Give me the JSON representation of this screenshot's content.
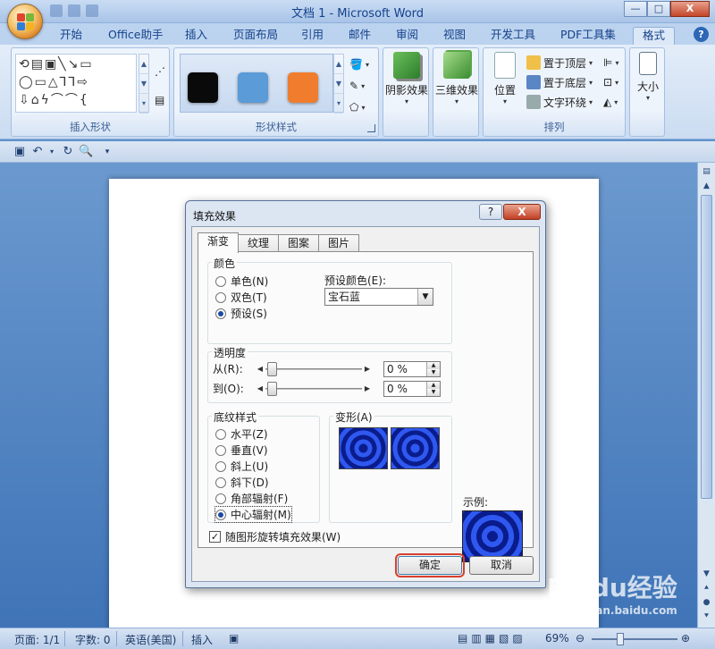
{
  "window": {
    "title": "文档 1 - Microsoft Word",
    "minimize": "—",
    "maximize": "□",
    "close": "X"
  },
  "tabs": [
    "开始",
    "Office助手",
    "插入",
    "页面布局",
    "引用",
    "邮件",
    "审阅",
    "视图",
    "开发工具",
    "PDF工具集",
    "格式"
  ],
  "active_tab": "格式",
  "help": "?",
  "ribbon": {
    "insert_shapes": {
      "label": "插入形状",
      "gallery": "↺▭▣╲╲▭\n◯▭△⅂⅂⇨\n⇩⌂∿⌒⌒{"
    },
    "shape_styles": {
      "label": "形状样式",
      "swatches": [
        "#0a0a0a",
        "#5a9bd8",
        "#ef7d2d"
      ]
    },
    "shadow": {
      "label": "阴影效果"
    },
    "three_d": {
      "label": "三维效果"
    },
    "arrange": {
      "label": "排列",
      "position": "位置",
      "bring_front": "置于顶层",
      "send_back": "置于底层",
      "wrap_text": "文字环绕"
    },
    "size": {
      "label": "大小"
    }
  },
  "dialog": {
    "title": "填充效果",
    "help": "?",
    "close": "X",
    "tabs": [
      "渐变",
      "纹理",
      "图案",
      "图片"
    ],
    "selected_tab": "渐变",
    "colors": {
      "legend": "颜色",
      "options": [
        "单色(N)",
        "双色(T)",
        "预设(S)"
      ],
      "selected": "预设(S)",
      "preset_label": "预设颜色(E):",
      "preset_value": "宝石蓝"
    },
    "transparency": {
      "legend": "透明度",
      "from_label": "从(R):",
      "to_label": "到(O):",
      "from_value": "0 %",
      "to_value": "0 %",
      "from_level": 0,
      "to_level": 0
    },
    "shading": {
      "legend": "底纹样式",
      "options": [
        "水平(Z)",
        "垂直(V)",
        "斜上(U)",
        "斜下(D)",
        "角部辐射(F)",
        "中心辐射(M)"
      ],
      "selected": "中心辐射(M)"
    },
    "variants": {
      "legend": "变形(A)"
    },
    "sample_label": "示例:",
    "rotate_checkbox": {
      "label": "随图形旋转填充效果(W)",
      "checked": true
    },
    "ok": "确定",
    "cancel": "取消"
  },
  "status": {
    "page": "页面: 1/1",
    "words": "字数: 0",
    "language": "英语(美国)",
    "mode": "插入",
    "zoom": "69%"
  },
  "watermark": {
    "brand": "Baidu经验",
    "sub": "jingyan.baidu.com"
  }
}
